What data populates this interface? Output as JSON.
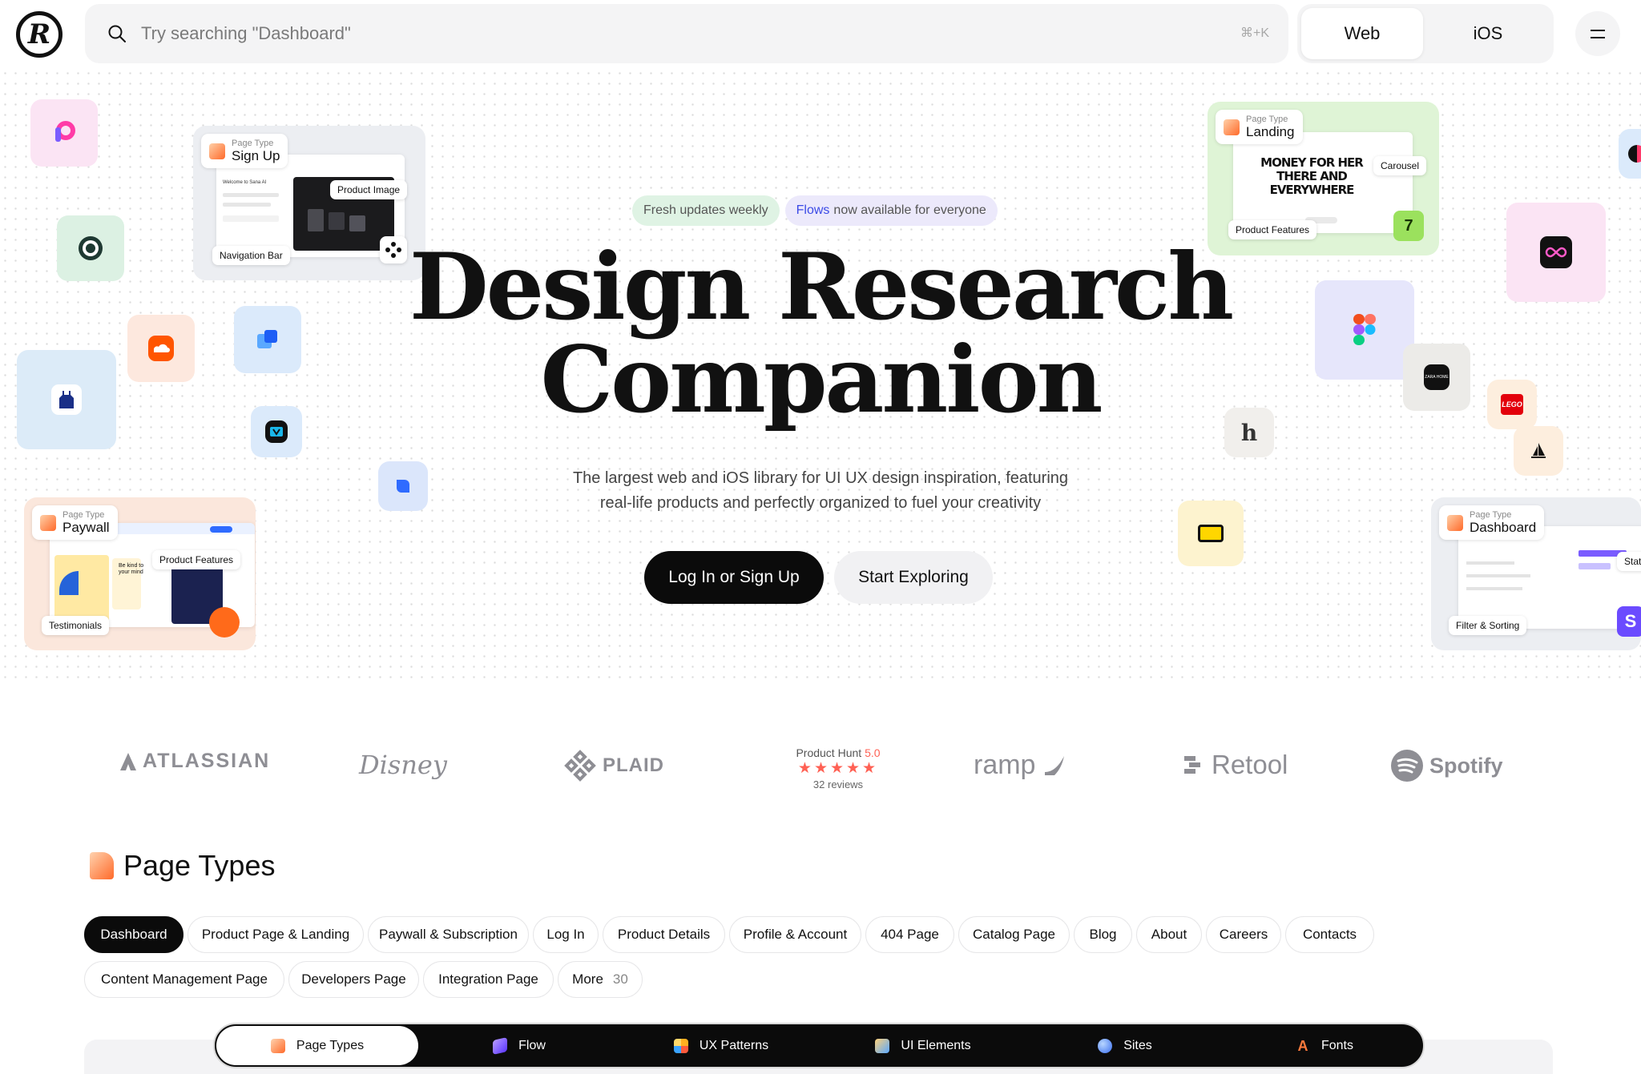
{
  "search": {
    "placeholder": "Try searching \"Dashboard\"",
    "shortcut": "⌘+K"
  },
  "platform": {
    "options": [
      "Web",
      "iOS"
    ],
    "selected": "Web"
  },
  "hero": {
    "pill_fresh": "Fresh updates weekly",
    "pill_flows_accent": "Flows",
    "pill_flows_rest": "now available for everyone",
    "title_line1": "Design Research",
    "title_line2": "Companion",
    "subtitle_line1": "The largest web and iOS library for UI UX design inspiration, featuring",
    "subtitle_line2": "real-life products and perfectly organized to fuel your creativity",
    "cta_primary": "Log In or Sign Up",
    "cta_secondary": "Start Exploring"
  },
  "cards": {
    "signup": {
      "kicker": "Page Type",
      "title": "Sign Up",
      "labels": [
        "Product Image",
        "Navigation Bar"
      ],
      "mock_text": "Welcome to Sana AI"
    },
    "paywall": {
      "kicker": "Page Type",
      "title": "Paywall",
      "labels": [
        "Product Features",
        "Testimonials"
      ],
      "mock_text": "Be kind to your mind"
    },
    "landing": {
      "kicker": "Page Type",
      "title": "Landing",
      "labels": [
        "Carousel",
        "Product Features"
      ],
      "headline_lines": [
        "MONEY FOR HER",
        "THERE AND",
        "EVERYWHERE"
      ]
    },
    "dashboard": {
      "kicker": "Page Type",
      "title": "Dashboard",
      "labels": [
        "Stats",
        "Filter & Sorting"
      ]
    }
  },
  "tiles": {
    "threads_h": "h",
    "lego": "LEGO",
    "zara": "ZARA HOME",
    "badge_s": "S"
  },
  "brands": [
    "ATLASSIAN",
    "Disney",
    "PLAID",
    "ramp",
    "Retool",
    "Spotify"
  ],
  "product_hunt": {
    "label": "Product Hunt",
    "score": "5.0",
    "stars": "★★★★★",
    "reviews": "32 reviews"
  },
  "page_types": {
    "title": "Page Types",
    "chips": [
      "Dashboard",
      "Product Page & Landing",
      "Paywall & Subscription",
      "Log In",
      "Product Details",
      "Profile & Account",
      "404 Page",
      "Catalog Page",
      "Blog",
      "About",
      "Careers",
      "Contacts",
      "Content Management Page",
      "Developers Page",
      "Integration Page",
      "More"
    ],
    "more_count": "30",
    "active": "Dashboard"
  },
  "bottom_nav": {
    "items": [
      "Page Types",
      "Flow",
      "UX Patterns",
      "UI Elements",
      "Sites",
      "Fonts"
    ],
    "active": "Page Types"
  }
}
